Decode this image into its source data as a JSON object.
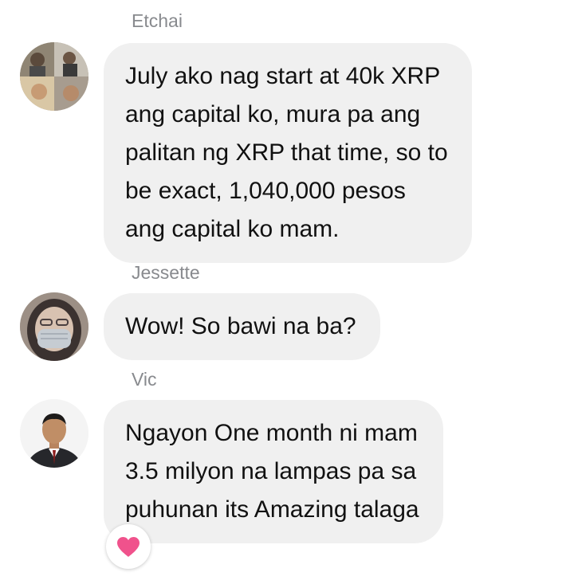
{
  "messages": [
    {
      "sender": "Etchai",
      "lines": [
        "July ako nag start at 40k XRP",
        "ang capital ko, mura pa ang",
        "palitan ng XRP that time, so to",
        "be exact, 1,040,000 pesos",
        "ang capital ko mam."
      ]
    },
    {
      "sender": "Jessette",
      "lines": [
        "Wow! So bawi na ba?"
      ]
    },
    {
      "sender": "Vic",
      "lines": [
        "Ngayon One month ni mam",
        "3.5 milyon na lampas pa sa",
        "puhunan its Amazing talaga"
      ],
      "reaction": "heart-icon"
    }
  ],
  "colors": {
    "bubble": "#f0f0f0",
    "sender_text": "#888a8e",
    "message_text": "#111111",
    "reaction_heart": "#f0528c"
  }
}
